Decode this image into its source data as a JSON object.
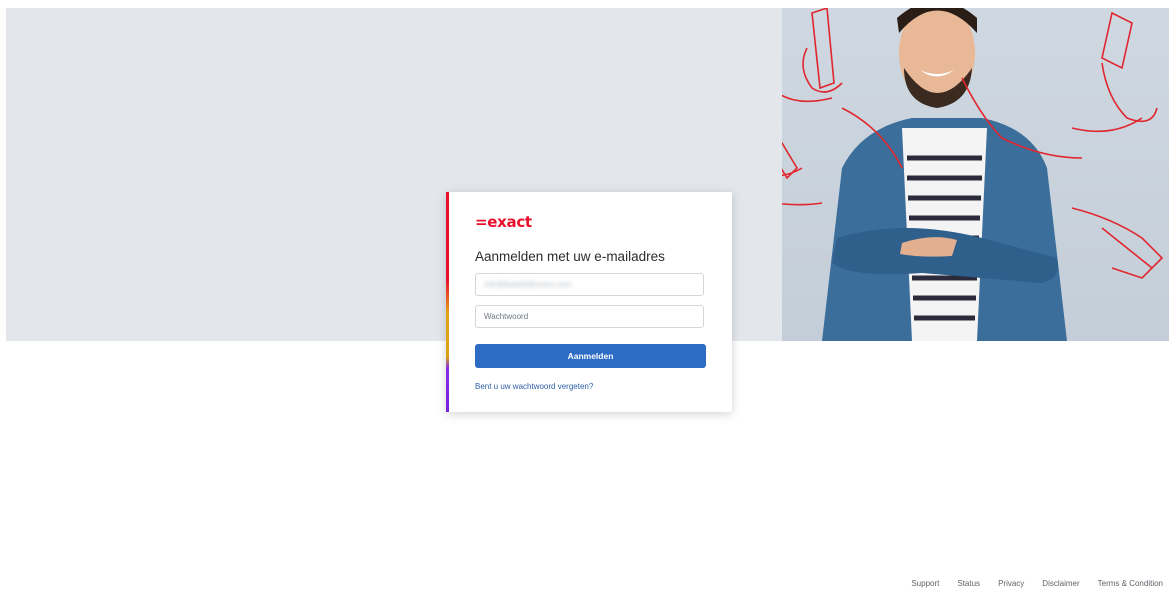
{
  "brand": {
    "logo_text": "=exact",
    "accent_color": "#e8102a"
  },
  "login": {
    "heading": "Aanmelden met uw e-mailadres",
    "email_value": "info@bedrijf@exact.com",
    "password_placeholder": "Wachtwoord",
    "submit_label": "Aanmelden",
    "forgot_link": "Bent u uw wachtwoord vergeten?",
    "button_color": "#2d6cc4"
  },
  "footer": {
    "links": [
      "Support",
      "Status",
      "Privacy",
      "Disclaimer",
      "Terms & Condition"
    ]
  }
}
